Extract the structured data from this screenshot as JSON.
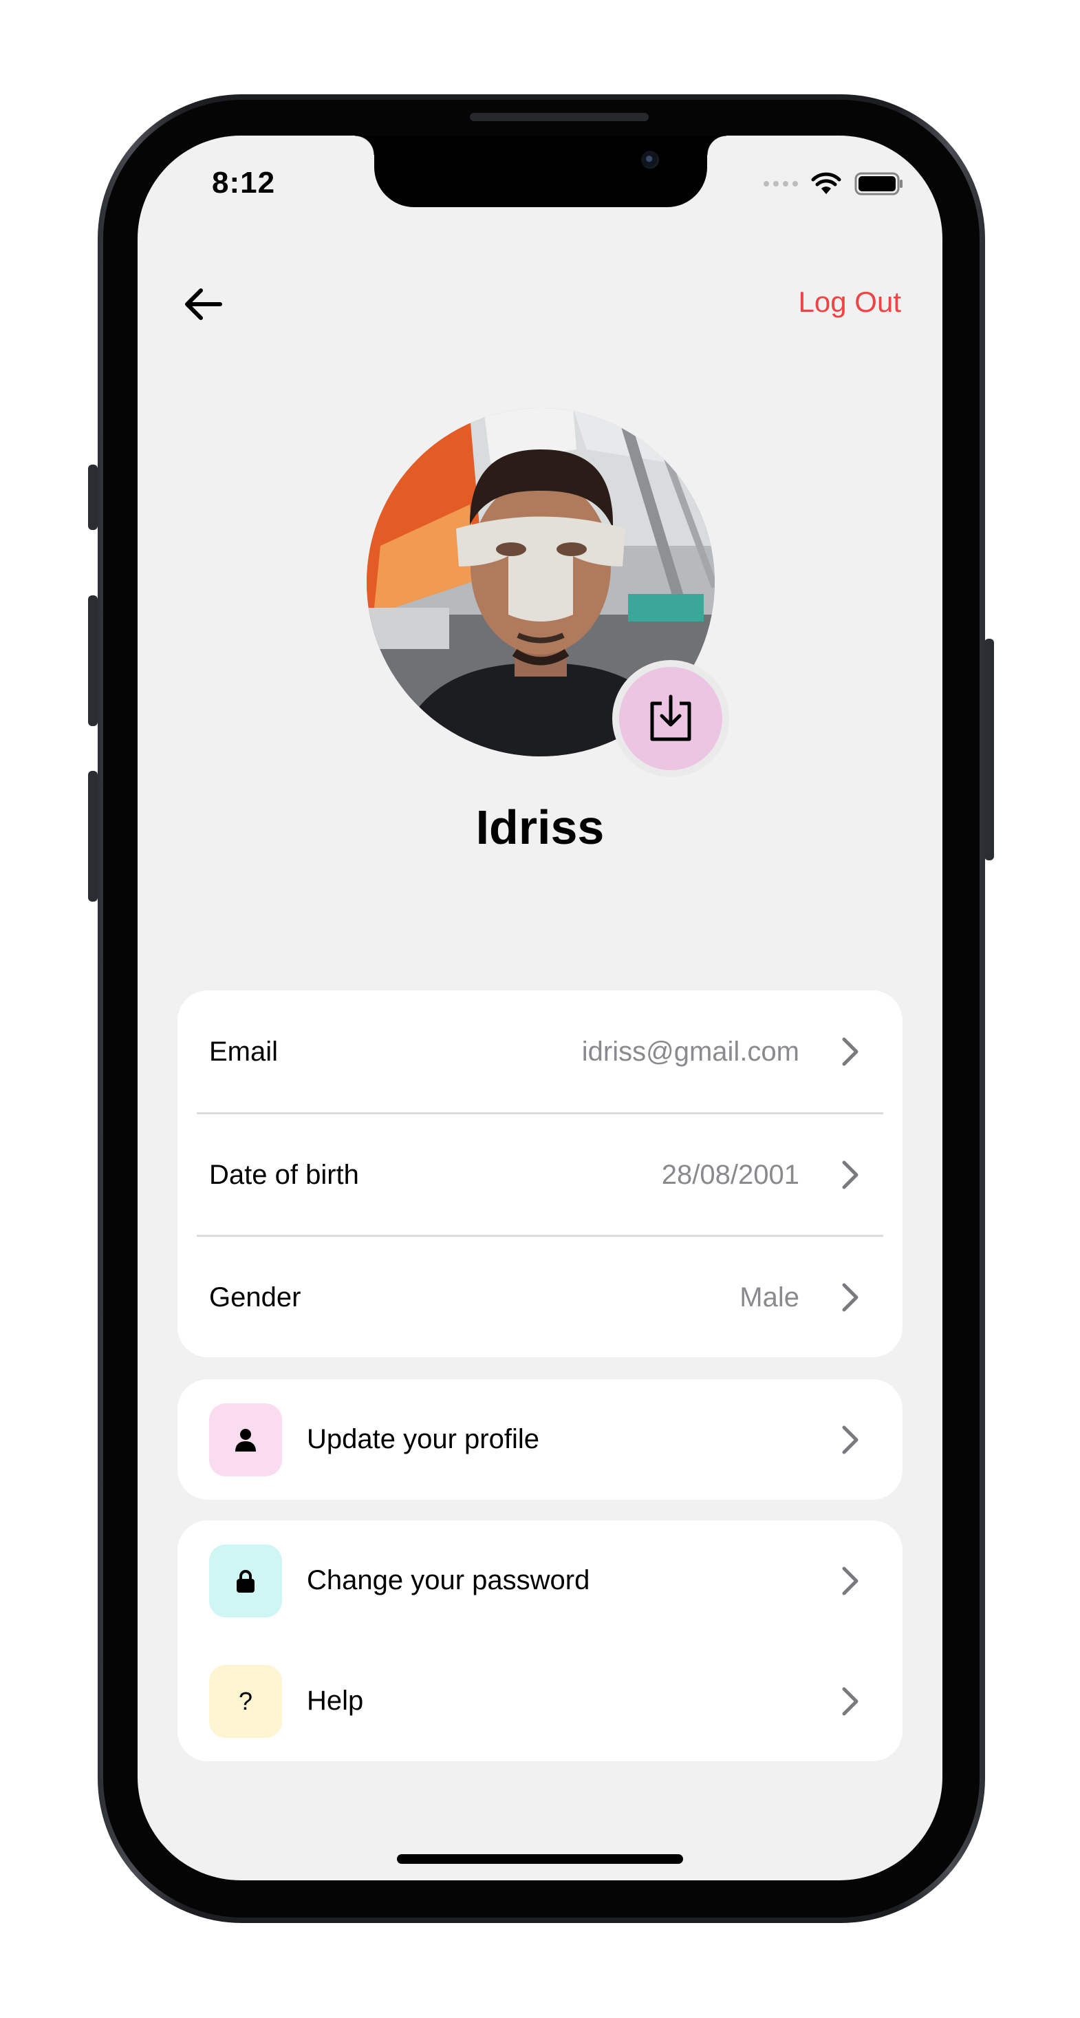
{
  "status_bar": {
    "time": "8:12"
  },
  "header": {
    "logout_label": "Log Out"
  },
  "profile": {
    "name": "Idriss"
  },
  "info_rows": [
    {
      "label": "Email",
      "value": "idriss@gmail.com"
    },
    {
      "label": "Date of birth",
      "value": "28/08/2001"
    },
    {
      "label": "Gender",
      "value": "Male"
    }
  ],
  "actions": [
    {
      "label": "Update your profile",
      "icon": "person-icon",
      "tile_color": "#fadcf0"
    },
    {
      "label": "Change your password",
      "icon": "lock-icon",
      "tile_color": "#cdf6f4"
    },
    {
      "label": "Help",
      "icon": "question-icon",
      "glyph": "?",
      "tile_color": "#fdf5d0"
    }
  ],
  "colors": {
    "logout": "#ee4444",
    "screen_bg": "#f1f1f1",
    "download_button": "#ebc5e2"
  }
}
